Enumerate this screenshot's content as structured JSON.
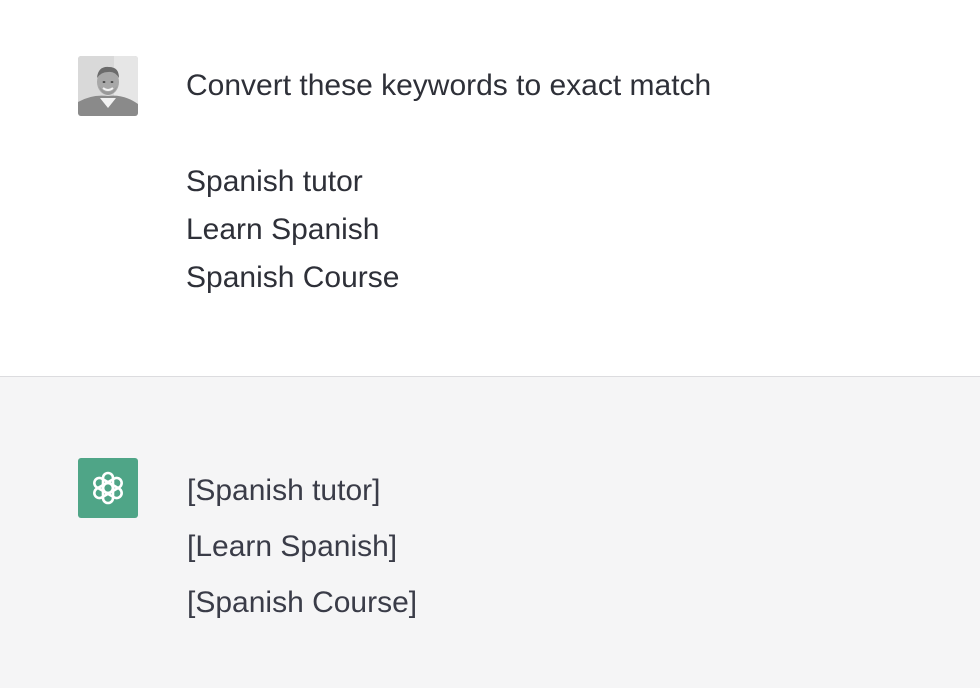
{
  "user_message": {
    "avatar": "user-photo",
    "prompt": "Convert these keywords to exact match",
    "keywords": [
      "Spanish tutor",
      "Learn Spanish",
      "Spanish Course"
    ]
  },
  "assistant_message": {
    "avatar": "openai-logo-icon",
    "avatar_color": "#4fa587",
    "lines": [
      "[Spanish tutor]",
      "[Learn Spanish]",
      "[Spanish Course]"
    ]
  },
  "colors": {
    "user_bg": "#ffffff",
    "assistant_bg": "#f5f5f6",
    "text": "#353740"
  }
}
